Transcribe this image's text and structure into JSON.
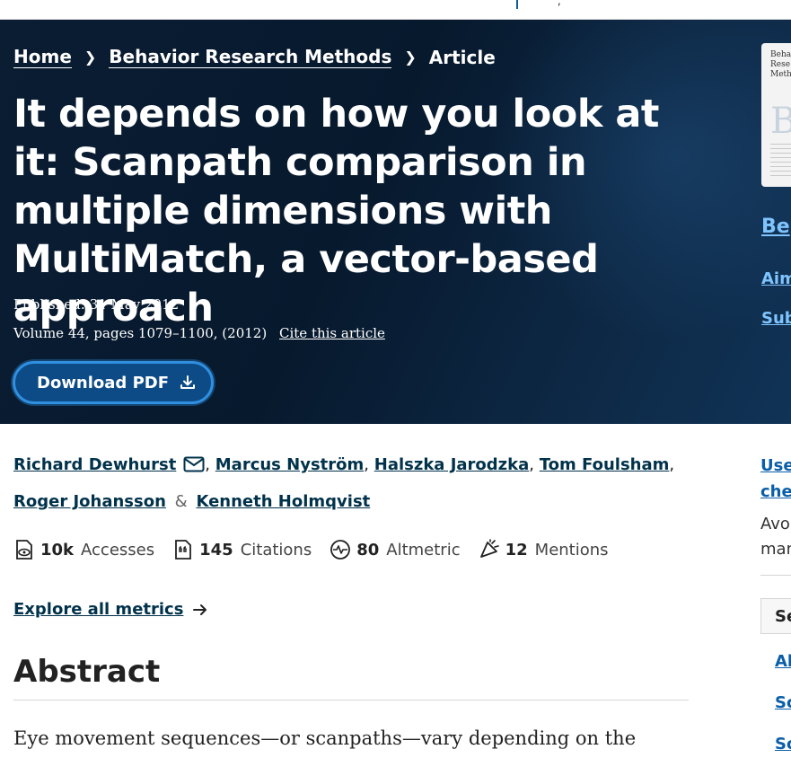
{
  "topbar": {
    "fragment": "’,"
  },
  "breadcrumb": {
    "home": "Home",
    "journal": "Behavior Research Methods",
    "current": "Article"
  },
  "article": {
    "title": "It depends on how you look at it: Scanpath comparison in multiple dimensions with MultiMatch, a vector-based approach",
    "published": "Published: 31 May 2012",
    "volume": "Volume 44, pages 1079–1100, (2012)",
    "cite_label": "Cite this article",
    "download_label": "Download PDF"
  },
  "sidebar": {
    "cover_text": "Beha Rese Meth",
    "cover_letter": "B",
    "journal_link": "Be",
    "link1": "Aim",
    "link2": "Sub",
    "use_line1": "Use",
    "use_line2": "che",
    "avoid_line1": "Avo",
    "avoid_line2": "man",
    "section_box": "Se",
    "nav1": "Al",
    "nav2": "Sc",
    "nav3": "Sc"
  },
  "authors": {
    "list": [
      "Richard Dewhurst",
      "Marcus Nyström",
      "Halszka Jarodzka",
      "Tom Foulsham",
      "Roger Johansson",
      "Kenneth Holmqvist"
    ],
    "separator": ",",
    "ampersand": "&"
  },
  "metrics": {
    "accesses_value": "10k",
    "accesses_label": "Accesses",
    "citations_value": "145",
    "citations_label": "Citations",
    "altmetric_value": "80",
    "altmetric_label": "Altmetric",
    "mentions_value": "12",
    "mentions_label": "Mentions",
    "explore_label": "Explore all metrics"
  },
  "abstract": {
    "heading": "Abstract",
    "text": "Eye movement sequences—or scanpaths—vary depending on the"
  },
  "colors": {
    "hero_bg": "#07192d",
    "link_dark": "#01324b",
    "link_blue": "#0a5ea8",
    "button_bg": "#0d4b86",
    "button_border": "#2f8fe0"
  }
}
